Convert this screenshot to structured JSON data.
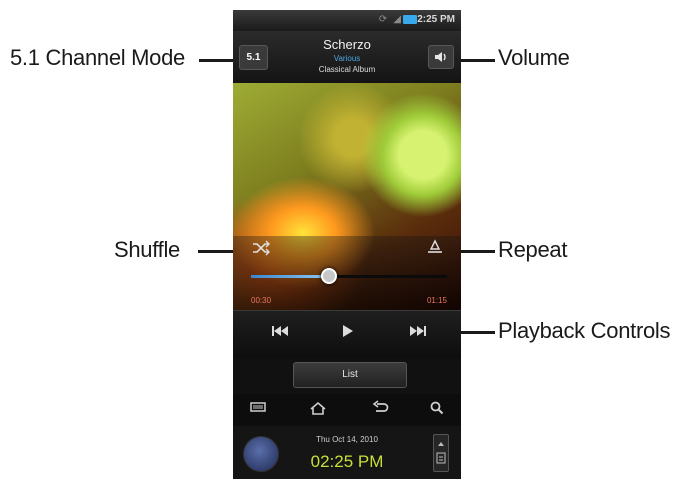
{
  "callouts": {
    "channel_mode": "5.1 Channel Mode",
    "volume": "Volume",
    "shuffle": "Shuffle",
    "repeat": "Repeat",
    "playback_controls": "Playback Controls"
  },
  "status_bar": {
    "time": "2:25 PM",
    "icons": [
      "sync-icon",
      "signal-icon",
      "battery-icon"
    ],
    "battery_color": "#38a9ea"
  },
  "now_playing": {
    "title": "Scherzo",
    "artist": "Various",
    "album": "Classical Album",
    "channel_button": "5.1",
    "volume_icon": "speaker-icon"
  },
  "playback": {
    "elapsed": "00:30",
    "total": "01:15",
    "progress_percent": 40,
    "shuffle_icon": "shuffle-icon",
    "repeat_icon": "repeat-icon"
  },
  "transport": {
    "buttons": [
      "previous-icon",
      "play-icon",
      "next-icon"
    ]
  },
  "list_button": "List",
  "softkeys": [
    "menu-icon",
    "home-icon",
    "back-icon",
    "search-icon"
  ],
  "lock_bar": {
    "date": "Thu Oct  14, 2010",
    "time": "02:25 PM",
    "accent": "#c9df3a"
  }
}
